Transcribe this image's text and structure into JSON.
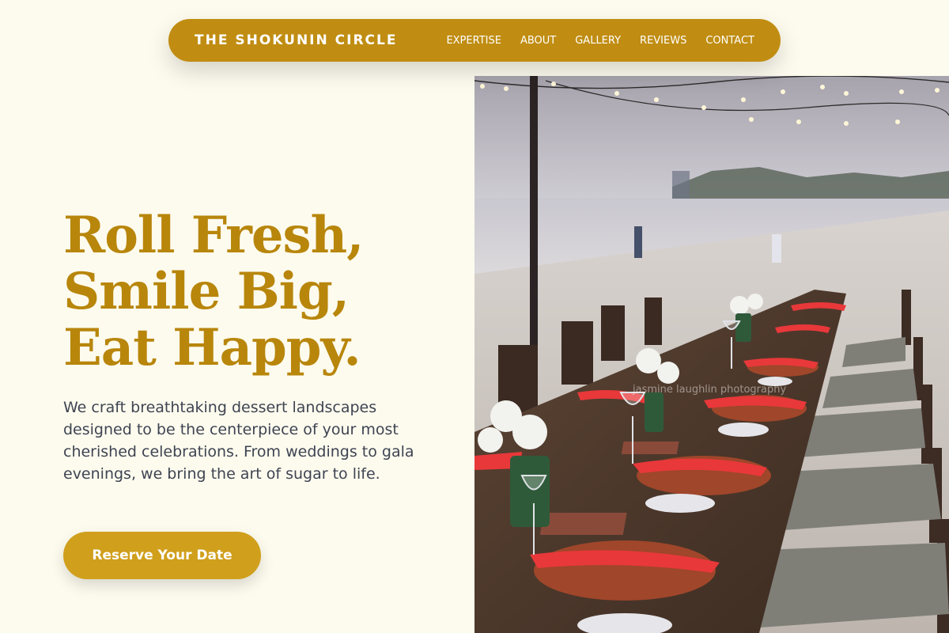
{
  "nav": {
    "brand": "THE SHOKUNIN CIRCLE",
    "links": [
      "EXPERTISE",
      "ABOUT",
      "GALLERY",
      "REVIEWS",
      "CONTACT"
    ]
  },
  "hero": {
    "title_lines": [
      "Roll Fresh,",
      "Smile Big,",
      "Eat Happy."
    ],
    "description": "We craft breathtaking dessert landscapes designed to be the centerpiece of your most cherished celebrations. From weddings to gala evenings, we bring the art of sugar to life.",
    "cta_label": "Reserve Your Date",
    "image_alt": "Long outdoor banquet table set on a beach with red napkins, wicker placemats, and string lights",
    "image_watermark": "jasmine laughlin photography"
  },
  "colors": {
    "background": "#fdfbee",
    "accent": "#c08d12",
    "title": "#b8860b",
    "button": "#d09f1c",
    "body_text": "#3e4452",
    "napkin_red": "#e8383a"
  }
}
